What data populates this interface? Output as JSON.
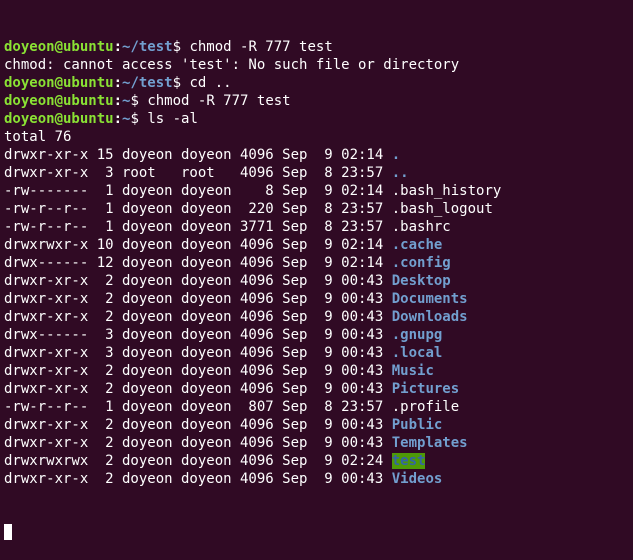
{
  "prompt": {
    "user_host": "doyeon@ubuntu",
    "colon": ":",
    "dollar": "$ "
  },
  "lines": [
    {
      "type": "cmd",
      "path": "~/test",
      "command": "chmod -R 777 test"
    },
    {
      "type": "out",
      "text": "chmod: cannot access 'test': No such file or directory"
    },
    {
      "type": "cmd",
      "path": "~/test",
      "command": "cd .."
    },
    {
      "type": "cmd",
      "path": "~",
      "command": "chmod -R 777 test"
    },
    {
      "type": "cmd",
      "path": "~",
      "command": "ls -al"
    },
    {
      "type": "out",
      "text": "total 76"
    }
  ],
  "listing": [
    {
      "meta": "drwxr-xr-x 15 doyeon doyeon 4096 Sep  9 02:14 ",
      "name": ".",
      "style": "dir"
    },
    {
      "meta": "drwxr-xr-x  3 root   root   4096 Sep  8 23:57 ",
      "name": "..",
      "style": "dir"
    },
    {
      "meta": "-rw-------  1 doyeon doyeon    8 Sep  9 02:14 ",
      "name": ".bash_history",
      "style": "plain"
    },
    {
      "meta": "-rw-r--r--  1 doyeon doyeon  220 Sep  8 23:57 ",
      "name": ".bash_logout",
      "style": "plain"
    },
    {
      "meta": "-rw-r--r--  1 doyeon doyeon 3771 Sep  8 23:57 ",
      "name": ".bashrc",
      "style": "plain"
    },
    {
      "meta": "drwxrwxr-x 10 doyeon doyeon 4096 Sep  9 02:14 ",
      "name": ".cache",
      "style": "dir"
    },
    {
      "meta": "drwx------ 12 doyeon doyeon 4096 Sep  9 02:14 ",
      "name": ".config",
      "style": "dir"
    },
    {
      "meta": "drwxr-xr-x  2 doyeon doyeon 4096 Sep  9 00:43 ",
      "name": "Desktop",
      "style": "dir"
    },
    {
      "meta": "drwxr-xr-x  2 doyeon doyeon 4096 Sep  9 00:43 ",
      "name": "Documents",
      "style": "dir"
    },
    {
      "meta": "drwxr-xr-x  2 doyeon doyeon 4096 Sep  9 00:43 ",
      "name": "Downloads",
      "style": "dir"
    },
    {
      "meta": "drwx------  3 doyeon doyeon 4096 Sep  9 00:43 ",
      "name": ".gnupg",
      "style": "dir"
    },
    {
      "meta": "drwxr-xr-x  3 doyeon doyeon 4096 Sep  9 00:43 ",
      "name": ".local",
      "style": "dir"
    },
    {
      "meta": "drwxr-xr-x  2 doyeon doyeon 4096 Sep  9 00:43 ",
      "name": "Music",
      "style": "dir"
    },
    {
      "meta": "drwxr-xr-x  2 doyeon doyeon 4096 Sep  9 00:43 ",
      "name": "Pictures",
      "style": "dir"
    },
    {
      "meta": "-rw-r--r--  1 doyeon doyeon  807 Sep  8 23:57 ",
      "name": ".profile",
      "style": "plain"
    },
    {
      "meta": "drwxr-xr-x  2 doyeon doyeon 4096 Sep  9 00:43 ",
      "name": "Public",
      "style": "dir"
    },
    {
      "meta": "drwxr-xr-x  2 doyeon doyeon 4096 Sep  9 00:43 ",
      "name": "Templates",
      "style": "dir"
    },
    {
      "meta": "drwxrwxrwx  2 doyeon doyeon 4096 Sep  9 02:24 ",
      "name": "test",
      "style": "hl"
    },
    {
      "meta": "drwxr-xr-x  2 doyeon doyeon 4096 Sep  9 00:43 ",
      "name": "Videos",
      "style": "dir"
    }
  ],
  "colors": {
    "background": "#300a24",
    "user_host": "#8ae234",
    "path": "#729fcf",
    "directory": "#729fcf",
    "other_writable_bg": "#4e9a06",
    "text": "#ffffff"
  }
}
